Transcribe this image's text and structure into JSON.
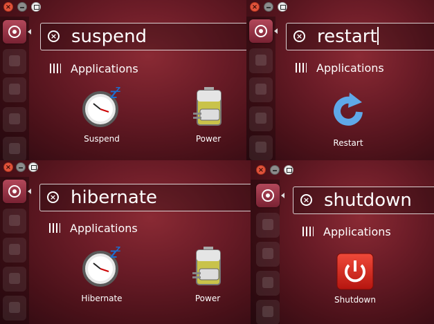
{
  "colors": {
    "accent": "#e2533b",
    "background": "#6b1c27"
  },
  "panels": [
    {
      "query": "suspend",
      "category": "Applications",
      "results": [
        {
          "label": "Suspend",
          "icon": "clock-sleep-icon"
        },
        {
          "label": "Power",
          "icon": "battery-plug-icon"
        }
      ]
    },
    {
      "query": "restart",
      "category": "Applications",
      "results": [
        {
          "label": "Restart",
          "icon": "restart-arrow-icon"
        }
      ]
    },
    {
      "query": "hibernate",
      "category": "Applications",
      "results": [
        {
          "label": "Hibernate",
          "icon": "clock-sleep-icon"
        },
        {
          "label": "Power",
          "icon": "battery-plug-icon"
        }
      ]
    },
    {
      "query": "shutdown",
      "category": "Applications",
      "results": [
        {
          "label": "Shutdown",
          "icon": "power-icon"
        }
      ]
    }
  ]
}
